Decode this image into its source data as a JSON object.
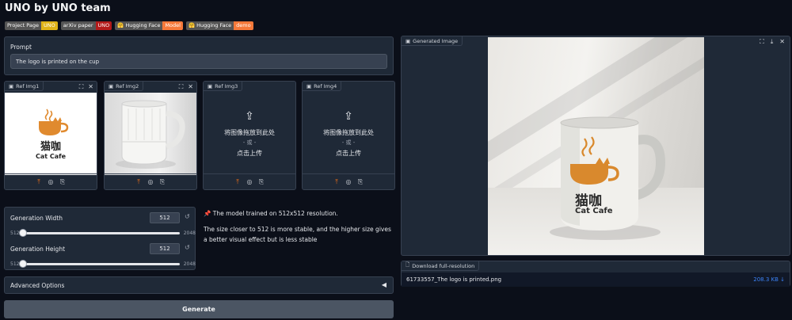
{
  "title": "UNO by UNO team",
  "badges": [
    {
      "left": "Project Page",
      "right": "UNO",
      "color": "#dfb317",
      "hf": false
    },
    {
      "left": "arXiv paper",
      "right": "UNO",
      "color": "#b31b1b",
      "hf": false
    },
    {
      "left": "Hugging Face",
      "right": "Model",
      "color": "#f5793a",
      "hf": true
    },
    {
      "left": "Hugging Face",
      "right": "demo",
      "color": "#f5793a",
      "hf": true
    }
  ],
  "prompt": {
    "label": "Prompt",
    "value": "The logo is printed on the cup"
  },
  "refs": [
    {
      "label": "Ref Img1"
    },
    {
      "label": "Ref Img2"
    },
    {
      "label": "Ref Img3",
      "drop": "将图像拖放到此处",
      "or": "- 或 -",
      "click": "点击上传"
    },
    {
      "label": "Ref Img4",
      "drop": "将图像拖放到此处",
      "or": "- 或 -",
      "click": "点击上传"
    }
  ],
  "logo": {
    "cn": "猫咖",
    "en": "Cat Cafe"
  },
  "width_slider": {
    "label": "Generation Width",
    "value": "512",
    "min": "512",
    "max": "2048",
    "fraction": 0.0
  },
  "height_slider": {
    "label": "Generation Height",
    "value": "512",
    "min": "512",
    "max": "2048",
    "fraction": 0.0
  },
  "note": {
    "line1": "The model trained on 512x512 resolution.",
    "line2": "The size closer to 512 is more stable, and the higher size gives a better visual effect but is less stable"
  },
  "advanced": {
    "label": "Advanced Options"
  },
  "generate_label": "Generate",
  "output": {
    "label": "Generated Image"
  },
  "download": {
    "label": "Download full-resolution",
    "filename": "61733557_The logo is printed.png",
    "size": "208.3 KB ↓"
  }
}
